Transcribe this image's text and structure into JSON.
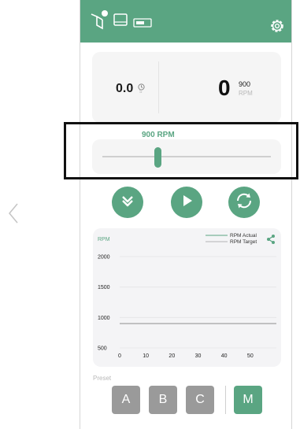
{
  "nav": {
    "back_icon": "chevron-left-icon"
  },
  "topbar": {
    "background": "#5aa582",
    "icons": [
      "device-connected-icon",
      "monitor-icon",
      "battery-icon",
      "gear-icon"
    ]
  },
  "status": {
    "time_value": "0.0",
    "time_unit": "s",
    "rpm_value": "0",
    "rpm_target": "900",
    "rpm_unit": "RPM"
  },
  "slider": {
    "label": "900 RPM",
    "level_fraction": 0.33
  },
  "controls": [
    "chevron-down-icon",
    "play-icon",
    "sync-icon"
  ],
  "chart": {
    "y_unit": "RPM",
    "legend": [
      "RPM Actual",
      "RPM Target"
    ],
    "share_icon": "share-icon"
  },
  "chart_data": {
    "type": "line",
    "ylabel": "RPM",
    "x_ticks": [
      "0",
      "10",
      "20",
      "30",
      "40",
      "50"
    ],
    "y_ticks": [
      "500",
      "1000",
      "1500",
      "2000"
    ],
    "xlim": [
      0,
      60
    ],
    "ylim": [
      500,
      2000
    ],
    "series": [
      {
        "name": "RPM Actual",
        "color": "#5aa582",
        "points": []
      },
      {
        "name": "RPM Target",
        "color": "#b5b5b5",
        "points": [
          [
            0,
            900
          ],
          [
            60,
            900
          ]
        ]
      }
    ],
    "grid": true,
    "legend_position": "top-right"
  },
  "preset": {
    "label": "Preset",
    "buttons": [
      "A",
      "B",
      "C"
    ],
    "mode_button": "M"
  },
  "accent": "#5aa582"
}
